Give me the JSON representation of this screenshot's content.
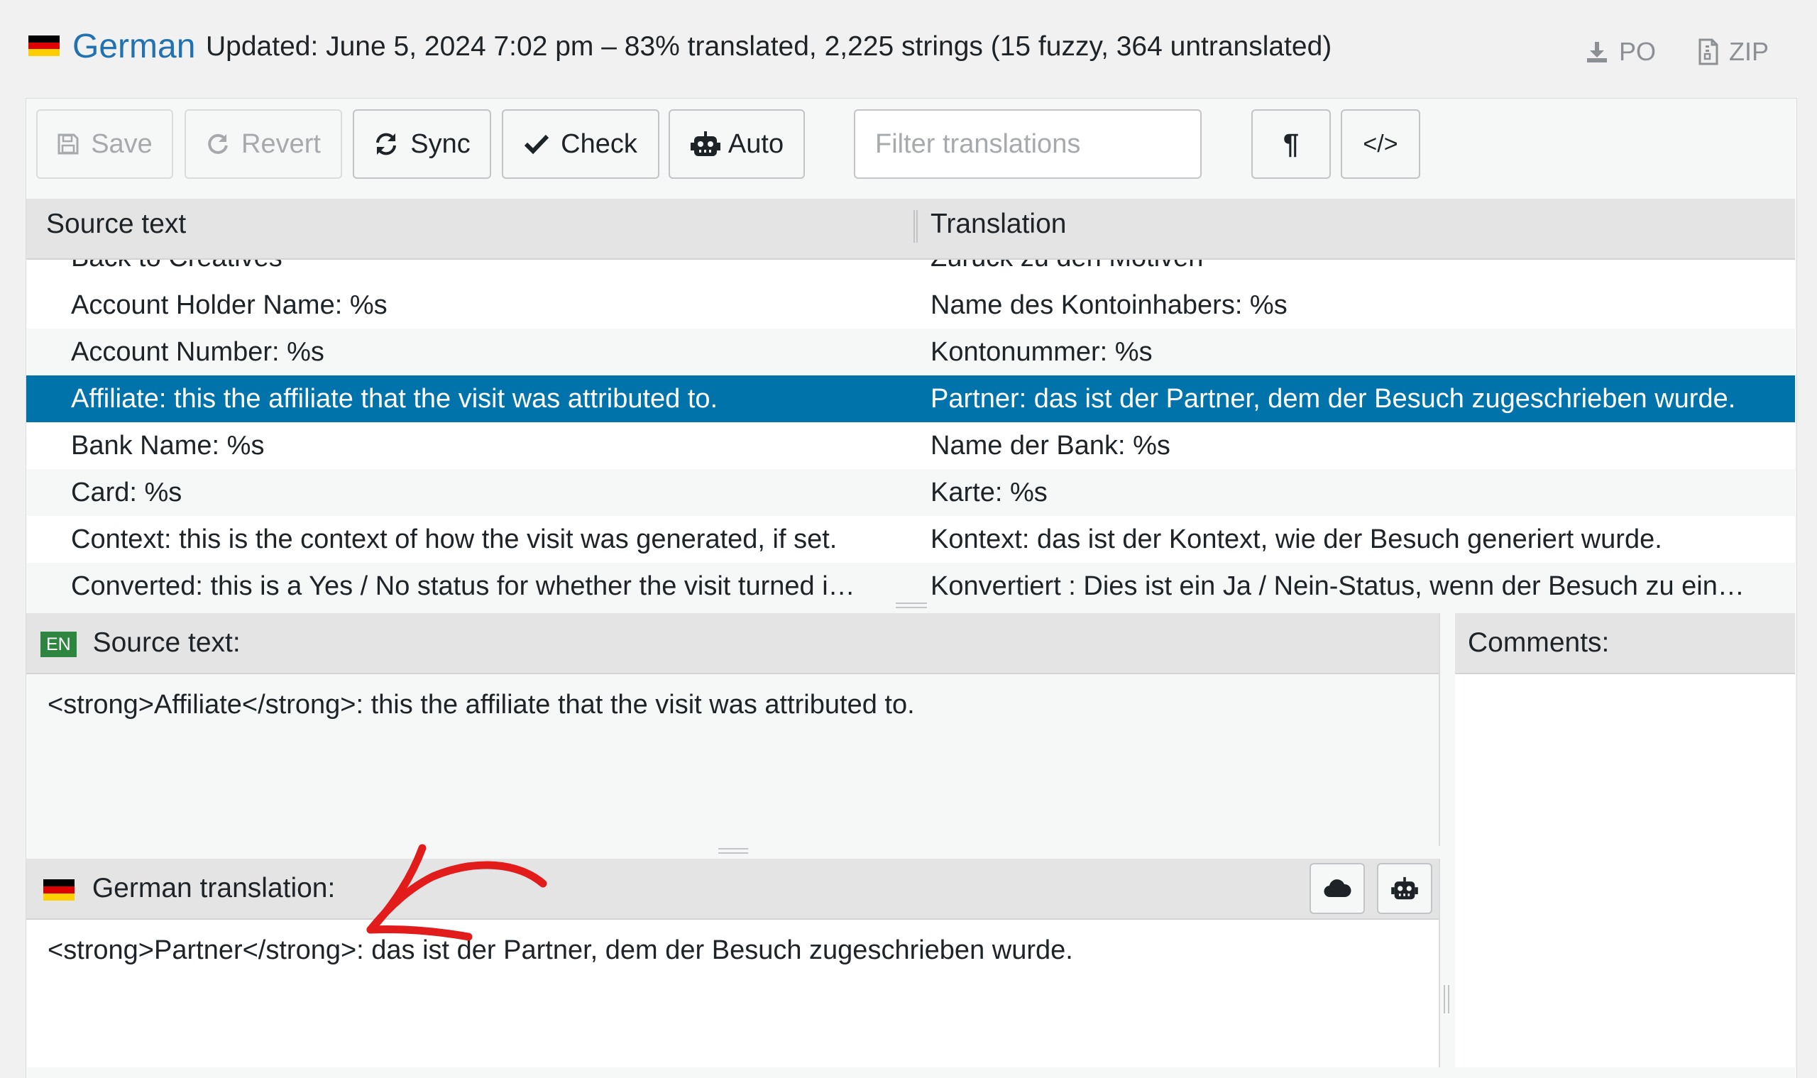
{
  "header": {
    "language": "German",
    "status_text": "Updated: June 5, 2024 7:02 pm – 83% translated, 2,225 strings (15 fuzzy, 364 untranslated)",
    "download_po": "PO",
    "download_zip": "ZIP"
  },
  "toolbar": {
    "save": "Save",
    "revert": "Revert",
    "sync": "Sync",
    "check": "Check",
    "auto": "Auto",
    "filter_placeholder": "Filter translations",
    "pilcrow": "¶",
    "code": "</>"
  },
  "table": {
    "col_source": "Source text",
    "col_translation": "Translation",
    "rows": [
      {
        "source": "Back to Creatives",
        "translation": "Zurück zu den Motiven"
      },
      {
        "source": "Account Holder Name: %s",
        "translation": "Name des Kontoinhabers: %s"
      },
      {
        "source": "Account Number: %s",
        "translation": "Kontonummer: %s"
      },
      {
        "source": "Affiliate: this the affiliate that the visit was attributed to.",
        "translation": "Partner: das ist der Partner, dem der Besuch zugeschrieben wurde.",
        "selected": true
      },
      {
        "source": "Bank Name: %s",
        "translation": "Name der Bank: %s"
      },
      {
        "source": "Card: %s",
        "translation": "Karte: %s"
      },
      {
        "source": "Context: this is the context of how the visit was generated, if set.",
        "translation": "Kontext: das ist der Kontext, wie der Besuch generiert wurde."
      },
      {
        "source": "Converted: this is a Yes / No status for whether the visit turned i…",
        "translation": "Konvertiert : Dies ist ein Ja / Nein-Status, wenn der Besuch zu ein…"
      }
    ]
  },
  "source_panel": {
    "badge": "EN",
    "label": "Source text:",
    "text": "<strong>Affiliate</strong>: this the affiliate that the visit was attributed to."
  },
  "comments_panel": {
    "label": "Comments:"
  },
  "translation_panel": {
    "label": "German translation:",
    "text": "<strong>Partner</strong>: das ist der Partner, dem der Besuch zugeschrieben wurde."
  },
  "colors": {
    "accent": "#2271b1",
    "selected_row": "#0073aa",
    "en_badge": "#2e8540",
    "annotation_arrow": "#e21b1b"
  },
  "icons": {
    "download_po": "download-icon",
    "download_zip": "zip-file-icon",
    "save": "floppy-disk-icon",
    "revert": "undo-icon",
    "sync": "sync-icon",
    "check": "checkmark-icon",
    "auto": "robot-icon",
    "cloud": "cloud-icon",
    "robot": "robot-icon"
  }
}
